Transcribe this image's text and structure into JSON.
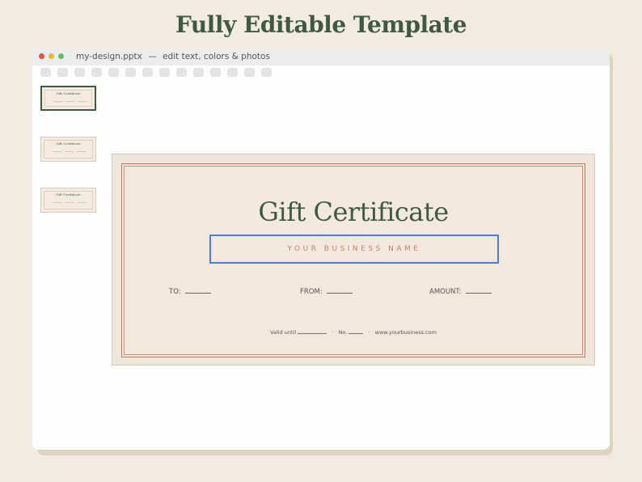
{
  "header": {
    "title": "Fully Editable Template"
  },
  "window": {
    "filename": "my-design.pptx",
    "separator": "—",
    "subtitle": "edit text, colors & photos",
    "toolbar_button_count": 14
  },
  "thumbnails": [
    {
      "title": "Gift Certificate",
      "selected": true
    },
    {
      "title": "Gift Certificate",
      "selected": false
    },
    {
      "title": "Gift Certificate",
      "selected": false
    }
  ],
  "certificate": {
    "title": "Gift Certificate",
    "business_name": "YOUR BUSINESS NAME",
    "to_label": "TO:",
    "from_label": "FROM:",
    "amount_label": "AMOUNT:",
    "valid_label": "Valid until",
    "number_label": "No.",
    "dot": "·",
    "website": "www.yourbusiness.com"
  },
  "colors": {
    "background": "#f2ebe1",
    "title_green": "#3f5a3e",
    "certificate_bg": "#f2e8de",
    "border_rose": "#b87a62",
    "selection_blue": "#4a7fd6"
  }
}
